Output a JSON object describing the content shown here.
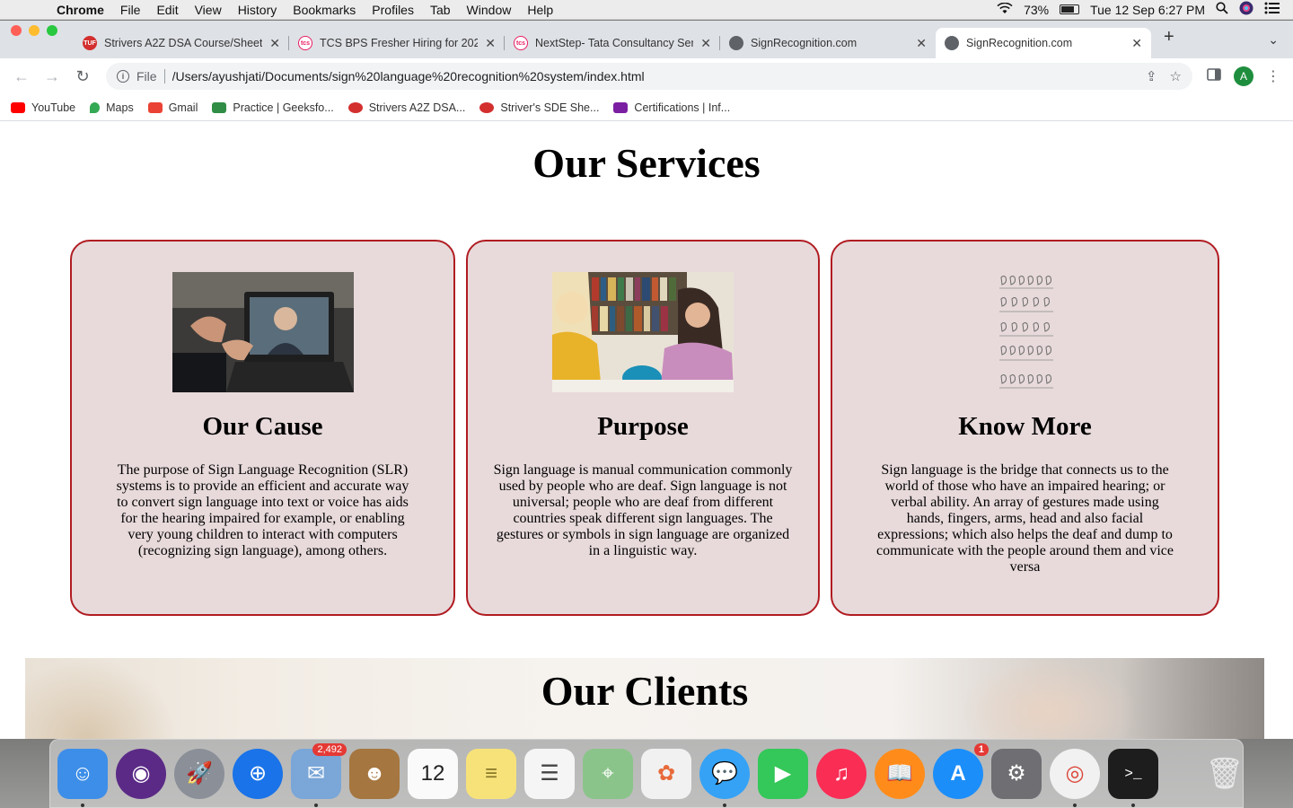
{
  "menubar": {
    "app_name": "Chrome",
    "items": [
      "File",
      "Edit",
      "View",
      "History",
      "Bookmarks",
      "Profiles",
      "Tab",
      "Window",
      "Help"
    ],
    "battery": "73%",
    "datetime": "Tue 12 Sep  6:27 PM"
  },
  "tabs": [
    {
      "title": "Strivers A2Z DSA Course/Sheet",
      "favicon_color": "#d32f2f",
      "favicon_text": "TUF"
    },
    {
      "title": "TCS BPS Fresher Hiring for 2023",
      "favicon_color": "#e91e63",
      "favicon_text": "tcs"
    },
    {
      "title": "NextStep- Tata Consultancy Services",
      "favicon_color": "#e91e63",
      "favicon_text": "tcs"
    },
    {
      "title": "SignRecognition.com",
      "favicon_color": "#5f6368",
      "favicon_text": ""
    },
    {
      "title": "SignRecognition.com",
      "favicon_color": "#5f6368",
      "favicon_text": "",
      "active": true
    }
  ],
  "toolbar": {
    "scheme": "File",
    "url": "/Users/ayushjati/Documents/sign%20language%20recognition%20system/index.html",
    "profile_initial": "A"
  },
  "bookmarks": [
    {
      "label": "YouTube",
      "color": "#ff0000"
    },
    {
      "label": "Maps",
      "color": "#34a853"
    },
    {
      "label": "Gmail",
      "color": "#ea4335"
    },
    {
      "label": "Practice | Geeksfo...",
      "color": "#2f8d46"
    },
    {
      "label": "Strivers A2Z DSA...",
      "color": "#d32f2f"
    },
    {
      "label": "Striver's SDE She...",
      "color": "#d32f2f"
    },
    {
      "label": "Certifications | Inf...",
      "color": "#7b1fa2"
    }
  ],
  "page": {
    "services_title": "Our Services",
    "cards": [
      {
        "title": "Our Cause",
        "text": "The purpose of Sign Language Recognition (SLR) systems is to provide an efficient and accurate way to convert sign language into text or voice has aids for the hearing impaired for example, or enabling very young children to interact with computers (recognizing sign language), among others."
      },
      {
        "title": "Purpose",
        "text": "Sign language is manual communication commonly used by people who are deaf. Sign language is not universal; people who are deaf from different countries speak different sign languages. The gestures or symbols in sign language are organized in a linguistic way."
      },
      {
        "title": "Know More",
        "text": "Sign language is the bridge that connects us to the world of those who have an impaired hearing; or verbal ability. An array of gestures made using hands, fingers, arms, head and also facial expressions; which also helps the deaf and dump to communicate with the people around them and vice versa"
      }
    ],
    "clients_title": "Our Clients"
  },
  "dock": {
    "apps": [
      {
        "name": "Finder",
        "color": "#3d8ee8",
        "glyph": "☺"
      },
      {
        "name": "Siri",
        "color": "#5b2a86",
        "glyph": "◉"
      },
      {
        "name": "Launchpad",
        "color": "#8a8f98",
        "glyph": "🚀"
      },
      {
        "name": "Safari",
        "color": "#1a73e8",
        "glyph": "⊕"
      },
      {
        "name": "Mail",
        "color": "#7aa6d8",
        "glyph": "✉",
        "badge": "2,492"
      },
      {
        "name": "Contacts",
        "color": "#a5763f",
        "glyph": "☻"
      },
      {
        "name": "Calendar",
        "color": "#fafafa",
        "glyph": "12"
      },
      {
        "name": "Notes",
        "color": "#f7e27a",
        "glyph": "≡"
      },
      {
        "name": "Reminders",
        "color": "#f5f5f5",
        "glyph": "☰"
      },
      {
        "name": "Maps",
        "color": "#8bc48a",
        "glyph": "⌖"
      },
      {
        "name": "Photos",
        "color": "#f1f1f1",
        "glyph": "✿"
      },
      {
        "name": "Messages",
        "color": "#35a2f5",
        "glyph": "💬"
      },
      {
        "name": "FaceTime",
        "color": "#34c759",
        "glyph": "▶"
      },
      {
        "name": "Music",
        "color": "#fa2d55",
        "glyph": "♫"
      },
      {
        "name": "Books",
        "color": "#ff8c1a",
        "glyph": "📖"
      },
      {
        "name": "App Store",
        "color": "#1c8ef9",
        "glyph": "A",
        "badge": "1"
      },
      {
        "name": "System Preferences",
        "color": "#6e6e73",
        "glyph": "⚙"
      },
      {
        "name": "Chrome",
        "color": "#f1f1f1",
        "glyph": "◎"
      },
      {
        "name": "Terminal",
        "color": "#1d1d1d",
        "glyph": ">_"
      }
    ],
    "trash": {
      "name": "Trash",
      "glyph": "🗑"
    }
  }
}
